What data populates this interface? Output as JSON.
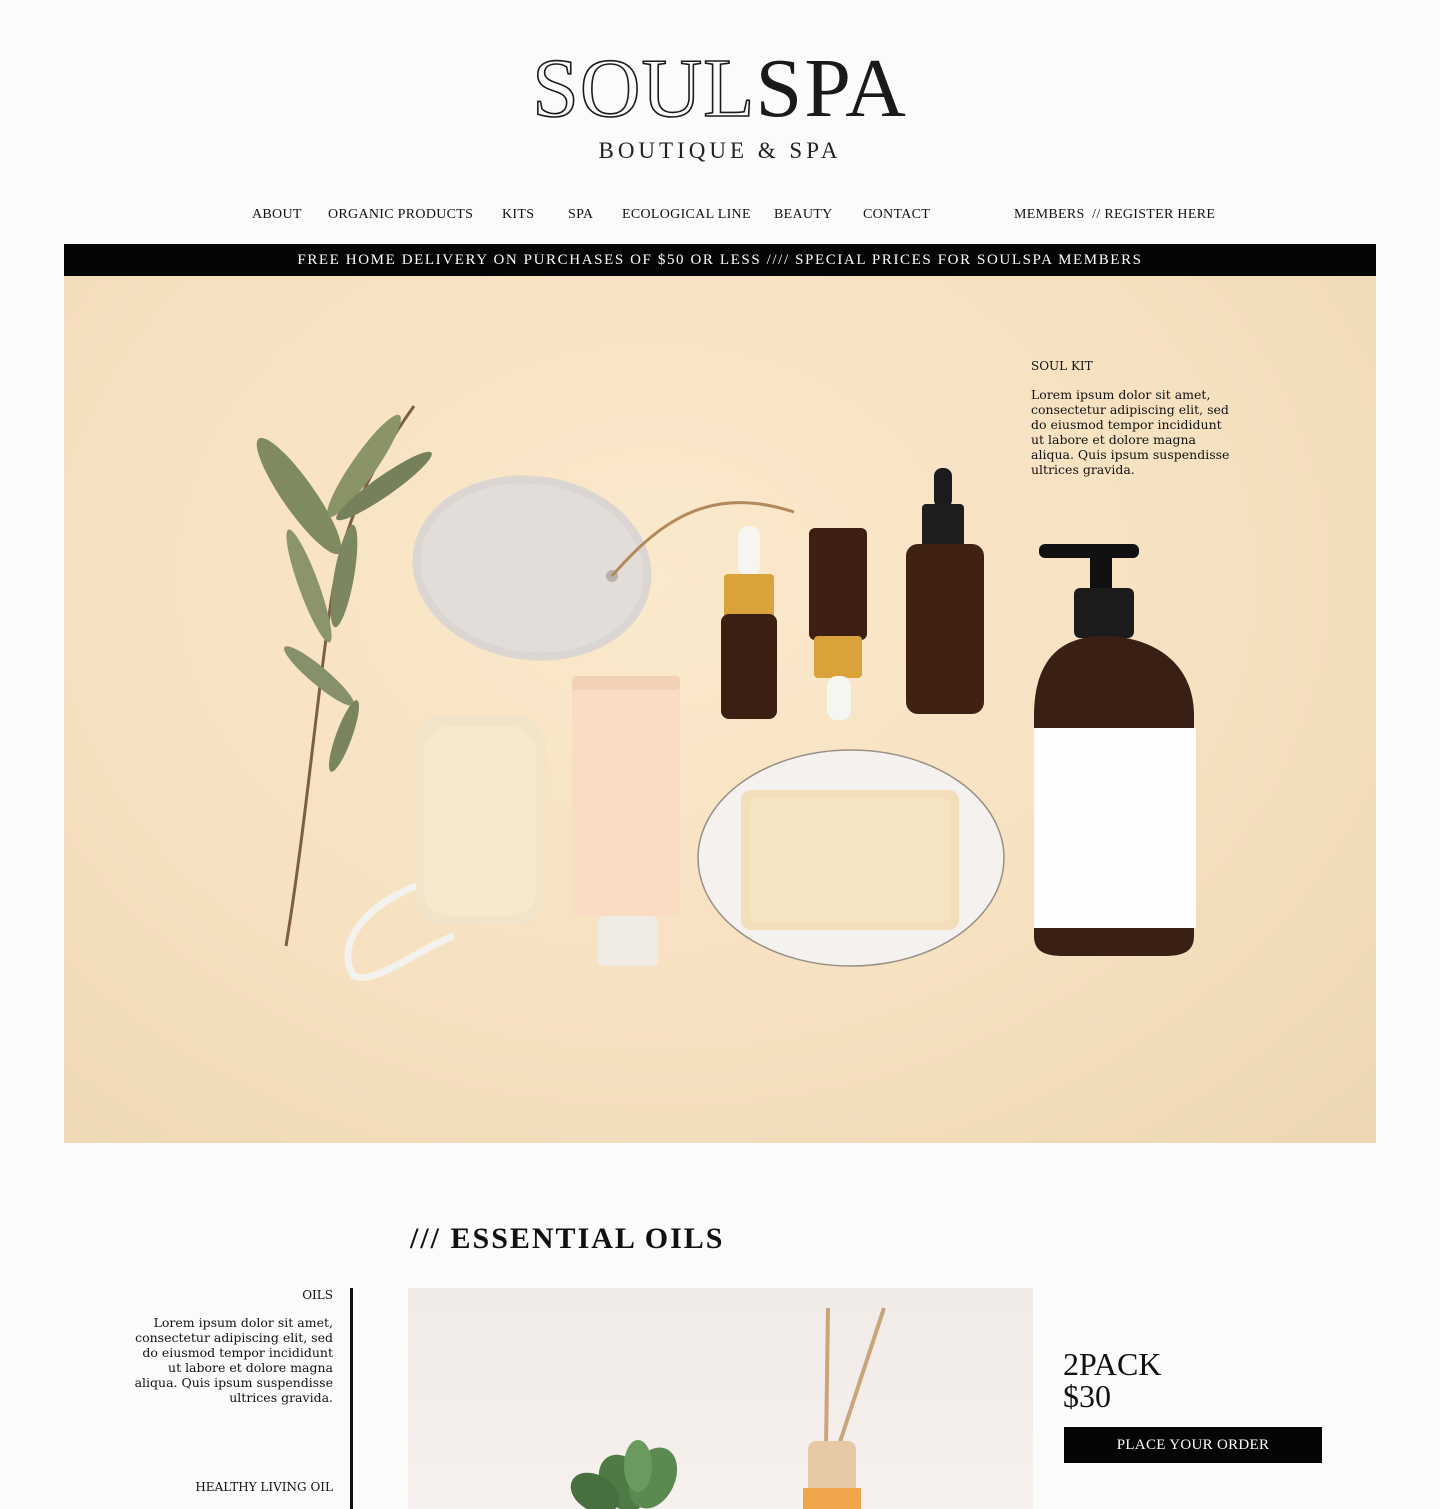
{
  "brand": {
    "logo_part1": "SOUL",
    "logo_part2": "SPA",
    "tagline": "BOUTIQUE & SPA"
  },
  "nav": {
    "items": [
      {
        "label": "ABOUT"
      },
      {
        "label": "ORGANIC PRODUCTS"
      },
      {
        "label": "KITS"
      },
      {
        "label": "SPA"
      },
      {
        "label": "ECOLOGICAL LINE"
      },
      {
        "label": "BEAUTY"
      },
      {
        "label": "CONTACT"
      }
    ],
    "members": "MEMBERS  // REGISTER HERE"
  },
  "banner": {
    "text": "FREE HOME DELIVERY ON PURCHASES OF $50 OR LESS //// SPECIAL PRICES FOR SOULSPA MEMBERS"
  },
  "hero": {
    "title": "SOUL KIT",
    "text": "Lorem ipsum dolor sit amet, consectetur adipiscing elit, sed do eiusmod tempor incididunt ut labore et dolore magna aliqua. Quis ipsum suspendisse ultrices gravida."
  },
  "section": {
    "heading": "/// ESSENTIAL OILS",
    "side_title": "OILS",
    "side_text": "Lorem ipsum dolor sit amet, consectetur adipiscing elit, sed do eiusmod tempor incididunt ut labore et dolore magna aliqua. Quis ipsum suspendisse ultrices gravida.",
    "side_title2": "HEALTHY LIVING OIL"
  },
  "product": {
    "name": "2PACK",
    "price": "$30",
    "cta": "PLACE YOUR ORDER"
  },
  "colors": {
    "background": "#fbfbfb",
    "banner": "#050505",
    "hero_bg": "#f6e1c0",
    "text": "#111111"
  }
}
